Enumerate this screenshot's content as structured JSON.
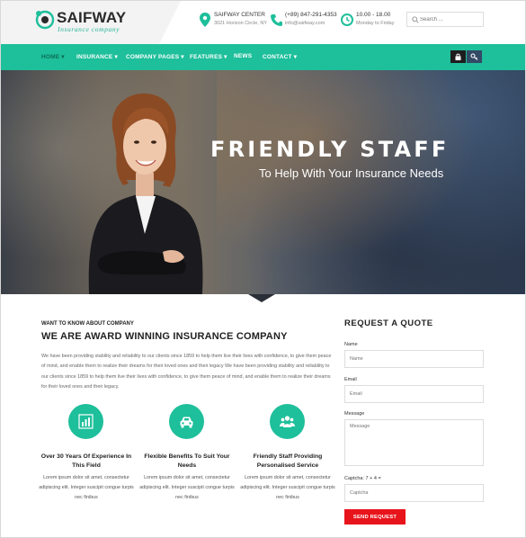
{
  "brand": {
    "name": "SAIFWAY",
    "tagline": "Insurance company",
    "accent": "#1ebf9b"
  },
  "header": {
    "address": {
      "icon": "map-pin-icon",
      "line1": "SAIFWAY CENTER",
      "line2": "3021 Horizon Circle, NY"
    },
    "phone": {
      "icon": "phone-icon",
      "line1": "(+89) 847-291-4353",
      "line2": "info@saifway.com"
    },
    "hours": {
      "icon": "clock-icon",
      "line1": "10.00 - 18.00",
      "line2": "Monday to Friday"
    },
    "search": {
      "placeholder": "Search ..."
    }
  },
  "nav": {
    "items": [
      {
        "label": "HOME ▾",
        "active": true
      },
      {
        "label": "INSURANCE ▾"
      },
      {
        "label": "COMPANY PAGES ▾"
      },
      {
        "label": "FEATURES ▾"
      },
      {
        "label": "NEWS"
      },
      {
        "label": "CONTACT ▾"
      }
    ],
    "buttons": [
      "lock-icon",
      "key-icon"
    ]
  },
  "hero": {
    "title": "FRIENDLY STAFF",
    "subtitle": "To Help With Your Insurance Needs"
  },
  "about": {
    "eyebrow": "WANT TO KNOW ABOUT COMPANY",
    "title": "WE ARE AWARD WINNING INSURANCE COMPANY",
    "paragraph": "We have been providing stability and reliability to our clients since 1859 to help them live their lives with confidence, to give them peace of mind, and enable them to realize their dreams for their loved ones and their legacy We have been providing stability and reliability to our clients since 1859 to help them live their lives with confidence, to give them peace of mind, and enable them to realize their dreams for their loved ones and their legacy."
  },
  "features": [
    {
      "icon": "bar-chart-icon",
      "title": "Over 30 Years Of Experience In This Field",
      "text": "Lorem ipsum dolor sit amet, consectetur adipiscing elit. Integer suscipit congue turpis nec finibus"
    },
    {
      "icon": "car-icon",
      "title": "Flexible Benefits To Suit Your Needs",
      "text": "Lorem ipsum dolor sit amet, consectetur adipiscing elit. Integer suscipit congue turpis nec finibus"
    },
    {
      "icon": "people-icon",
      "title": "Friendly Staff Providing Personalised Service",
      "text": "Lorem ipsum dolor sit amet, consectetur adipiscing elit. Integer suscipit congue turpis nec finibus"
    }
  ],
  "form": {
    "title": "REQUEST A QUOTE",
    "name_label": "Name",
    "name_placeholder": "Name",
    "email_label": "Email",
    "email_placeholder": "Email",
    "message_label": "Message",
    "message_placeholder": "Message",
    "captcha_label": "Captcha: 7 + 4 =",
    "captcha_placeholder": "Captcha",
    "submit_label": "SEND REQUEST",
    "submit_color": "#e8141c"
  }
}
